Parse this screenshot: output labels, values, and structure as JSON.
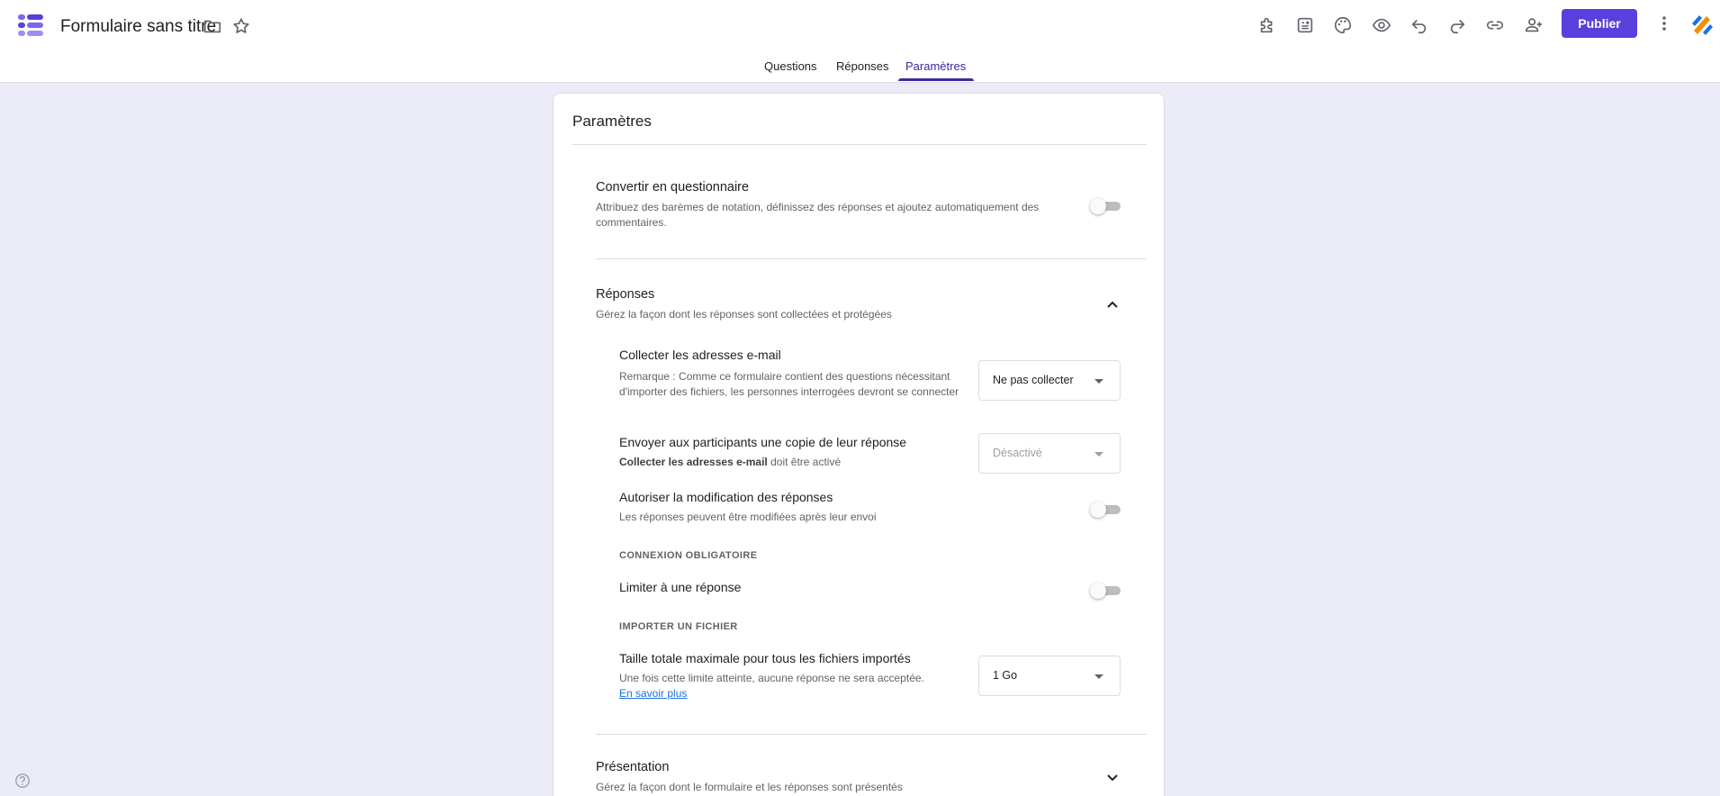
{
  "header": {
    "title": "Formulaire sans titre",
    "publish_label": "Publier"
  },
  "tabs": [
    {
      "label": "Questions"
    },
    {
      "label": "Réponses"
    },
    {
      "label": "Paramètres",
      "active": true
    }
  ],
  "icons": {
    "logo": "forms-logo",
    "folder": "folder-icon",
    "star": "star-icon",
    "addons": "puzzle-icon",
    "customize": "palette-icon",
    "preview": "eye-icon",
    "undo": "undo-icon",
    "redo": "redo-icon",
    "link": "link-icon",
    "collaborators": "add-person-icon",
    "more": "more-vert-icon",
    "help": "help-icon"
  },
  "colors": {
    "accent": "#5a3fdc",
    "tab_active": "#3b2aa0",
    "background": "#ecebf8"
  },
  "settings": {
    "title": "Paramètres",
    "quiz": {
      "title": "Convertir en questionnaire",
      "description": "Attribuez des barèmes de notation, définissez des réponses et ajoutez automatiquement des commentaires.",
      "enabled": false
    },
    "responses": {
      "title": "Réponses",
      "description": "Gérez la façon dont les réponses sont collectées et protégées",
      "expanded": true,
      "collect_emails": {
        "title": "Collecter les adresses e-mail",
        "note": "Remarque : Comme ce formulaire contient des questions nécessitant d'importer des fichiers, les personnes interrogées devront se connecter",
        "value": "Ne pas collecter"
      },
      "send_copy": {
        "title": "Envoyer aux participants une copie de leur réponse",
        "note_bold": "Collecter les adresses e-mail",
        "note_rest": " doit être activé",
        "value": "Désactivé"
      },
      "allow_edit": {
        "title": "Autoriser la modification des réponses",
        "description": "Les réponses peuvent être modifiées après leur envoi",
        "enabled": false
      },
      "login_section": "CONNEXION OBLIGATOIRE",
      "limit_one": {
        "title": "Limiter à une réponse",
        "enabled": false
      },
      "upload_section": "IMPORTER UN FICHIER",
      "max_size": {
        "title": "Taille totale maximale pour tous les fichiers importés",
        "description": "Une fois cette limite atteinte, aucune réponse ne sera acceptée.",
        "link": "En savoir plus",
        "value": "1 Go"
      }
    },
    "presentation": {
      "title": "Présentation",
      "description": "Gérez la façon dont le formulaire et les réponses sont présentés",
      "expanded": false
    }
  }
}
